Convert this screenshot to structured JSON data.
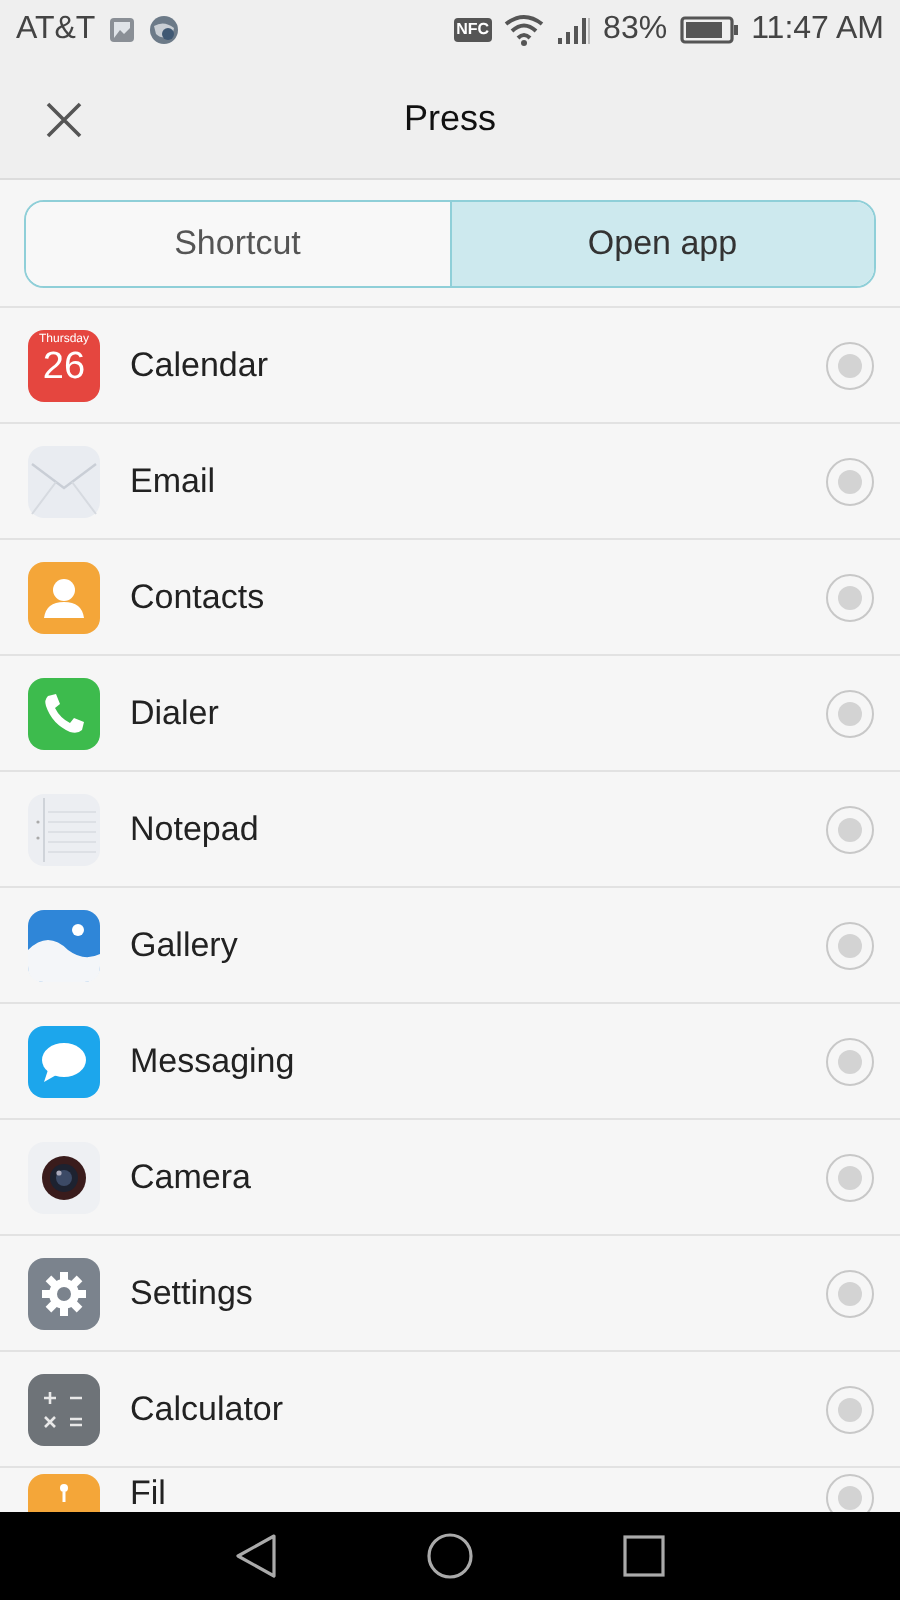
{
  "status_bar": {
    "carrier": "AT&T",
    "nfc_label": "NFC",
    "battery": "83%",
    "time": "11:47 AM"
  },
  "header": {
    "title": "Press"
  },
  "tabs": [
    {
      "label": "Shortcut",
      "selected": false
    },
    {
      "label": "Open app",
      "selected": true
    }
  ],
  "apps": [
    {
      "kind": "calendar",
      "label": "Calendar",
      "weekday": "Thursday",
      "day": "26",
      "selected": false
    },
    {
      "kind": "email",
      "label": "Email",
      "selected": false
    },
    {
      "kind": "contacts",
      "label": "Contacts",
      "selected": false
    },
    {
      "kind": "dialer",
      "label": "Dialer",
      "selected": false
    },
    {
      "kind": "notepad",
      "label": "Notepad",
      "selected": false
    },
    {
      "kind": "gallery",
      "label": "Gallery",
      "selected": false
    },
    {
      "kind": "messaging",
      "label": "Messaging",
      "selected": false
    },
    {
      "kind": "camera",
      "label": "Camera",
      "selected": false
    },
    {
      "kind": "settings",
      "label": "Settings",
      "selected": false
    },
    {
      "kind": "calculator",
      "label": "Calculator",
      "selected": false
    },
    {
      "kind": "files",
      "label": "Fil",
      "selected": false
    }
  ]
}
